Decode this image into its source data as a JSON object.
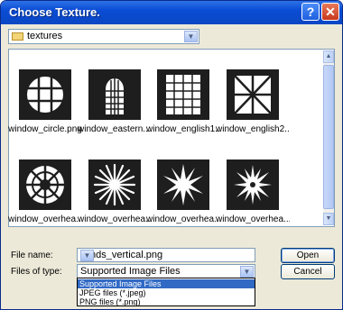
{
  "window": {
    "title": "Choose Texture."
  },
  "titlebar": {
    "help_glyph": "?",
    "close_glyph": "✕"
  },
  "location": {
    "folder": "textures"
  },
  "files": [
    {
      "name": "window_circle.png",
      "icon": "circle-window"
    },
    {
      "name": "window_eastern....",
      "icon": "arch-window"
    },
    {
      "name": "window_english1....",
      "icon": "grid-window"
    },
    {
      "name": "window_english2....",
      "icon": "diamond-window"
    },
    {
      "name": "window_overhea...",
      "icon": "radial-window"
    },
    {
      "name": "window_overhea...",
      "icon": "radial-window"
    },
    {
      "name": "window_overhea...",
      "icon": "star-window"
    },
    {
      "name": "window_overhea...",
      "icon": "star-window"
    }
  ],
  "form": {
    "file_name_label": "File name:",
    "file_name_value": "blinds_vertical.png",
    "file_type_label": "Files of type:",
    "file_type_value": "Supported Image Files",
    "file_type_options": [
      "Supported Image Files",
      "JPEG files (*.jpeg)",
      "PNG files (*.png)"
    ]
  },
  "buttons": {
    "open": "Open",
    "cancel": "Cancel"
  }
}
